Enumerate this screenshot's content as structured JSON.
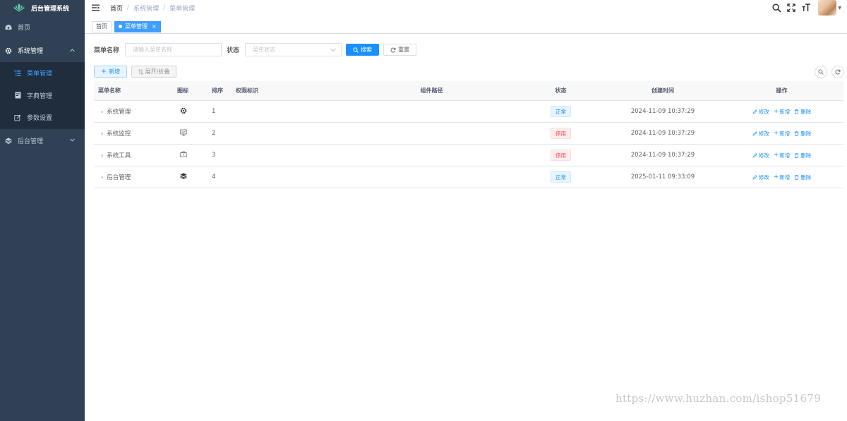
{
  "app": {
    "title": "后台管理系统"
  },
  "sidebar": {
    "items": [
      {
        "label": "首页",
        "icon": "dashboard-icon"
      },
      {
        "label": "系统管理",
        "icon": "gear-icon",
        "expanded": true,
        "children": [
          {
            "label": "菜单管理",
            "icon": "tree-table-icon",
            "active": true
          },
          {
            "label": "字典管理",
            "icon": "dict-icon"
          },
          {
            "label": "参数设置",
            "icon": "edit-icon"
          }
        ]
      },
      {
        "label": "后台管理",
        "icon": "layers-icon",
        "expanded": false
      }
    ]
  },
  "breadcrumb": [
    "首页",
    "系统管理",
    "菜单管理"
  ],
  "tags": [
    {
      "label": "首页",
      "active": false
    },
    {
      "label": "菜单管理",
      "active": true,
      "close": "×"
    }
  ],
  "search": {
    "name_label": "菜单名称",
    "name_placeholder": "请输入菜单名称",
    "status_label": "状态",
    "status_placeholder": "菜单状态",
    "search_btn": "搜索",
    "reset_btn": "重置"
  },
  "toolbar": {
    "add_btn": "新增",
    "expand_btn": "展开/折叠"
  },
  "table": {
    "headers": {
      "name": "菜单名称",
      "icon": "图标",
      "order": "排序",
      "perm": "权限标识",
      "path": "组件路径",
      "status": "状态",
      "time": "创建时间",
      "ops": "操作"
    },
    "rows": [
      {
        "name": "系统管理",
        "icon": "gear-icon",
        "order": "1",
        "perm": "",
        "path": "",
        "status": "正常",
        "status_type": "ok",
        "time": "2024-11-09 10:37:29"
      },
      {
        "name": "系统监控",
        "icon": "monitor-icon",
        "order": "2",
        "perm": "",
        "path": "",
        "status": "停用",
        "status_type": "stop",
        "time": "2024-11-09 10:37:29"
      },
      {
        "name": "系统工具",
        "icon": "toolbox-icon",
        "order": "3",
        "perm": "",
        "path": "",
        "status": "停用",
        "status_type": "stop",
        "time": "2024-11-09 10:37:29"
      },
      {
        "name": "后台管理",
        "icon": "layers-icon",
        "order": "4",
        "perm": "",
        "path": "",
        "status": "正常",
        "status_type": "ok",
        "time": "2025-01-11 09:33:09"
      }
    ],
    "ops": {
      "edit": "修改",
      "add": "新增",
      "delete": "删除"
    }
  },
  "colors": {
    "sidebar": "#304156",
    "submenu": "#1f2d3d",
    "primary": "#1890ff",
    "danger": "#ff4949"
  },
  "watermark": "https://www.huzhan.com/ishop51679"
}
